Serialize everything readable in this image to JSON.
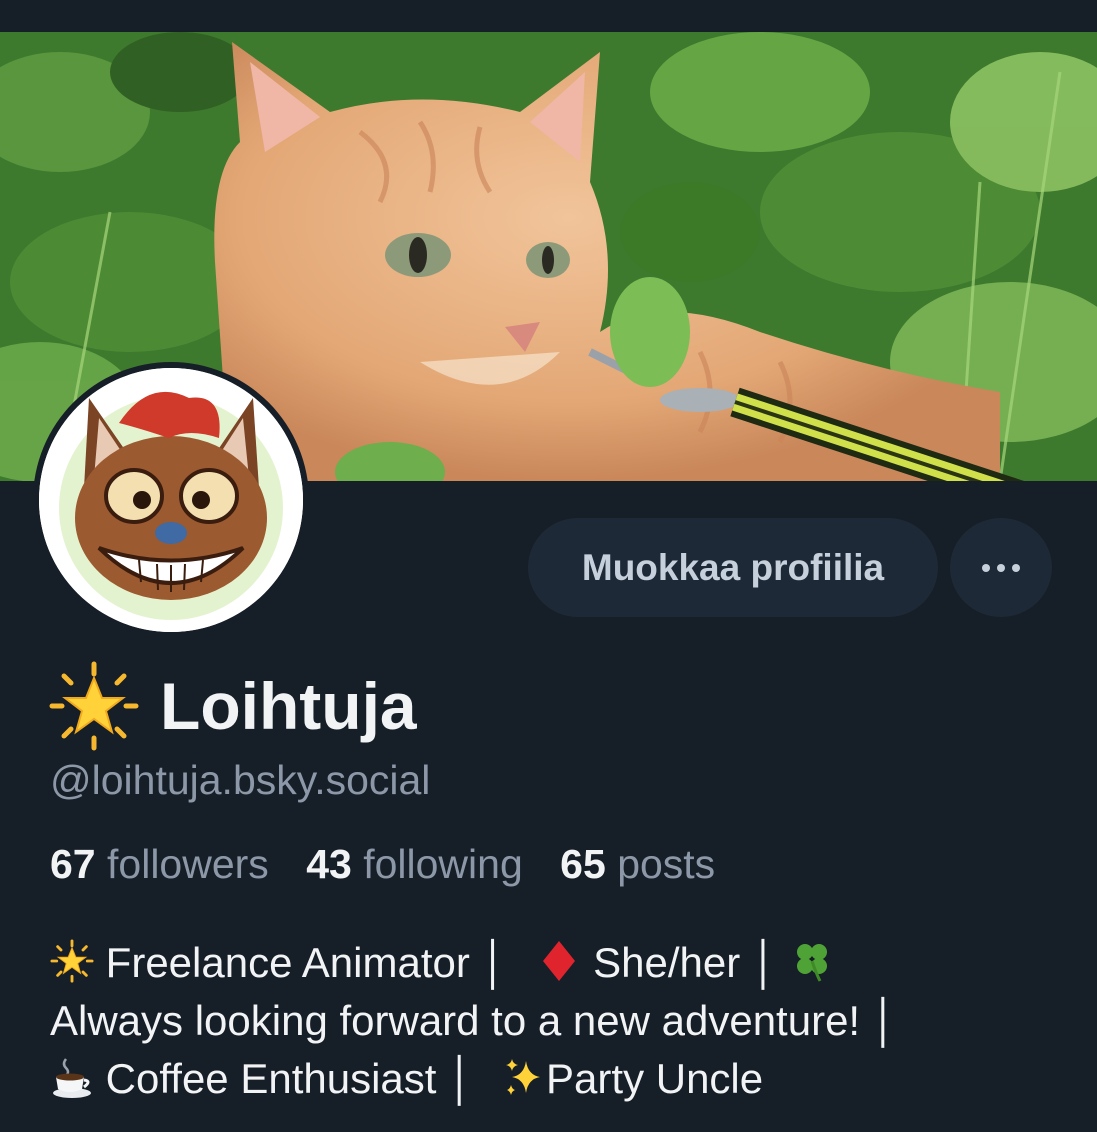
{
  "profile": {
    "display_name": "Loihtuja",
    "name_icon": "glowing-star-icon",
    "handle": "@loihtuja.bsky.social",
    "banner_image": "orange-tabby-cat-in-grass-photo",
    "avatar_image": "cartoon-fox-character-avatar"
  },
  "actions": {
    "edit_profile_label": "Muokkaa profiilia",
    "more_icon": "ellipsis-icon"
  },
  "stats": {
    "followers_count": "67",
    "followers_label": "followers",
    "following_count": "43",
    "following_label": "following",
    "posts_count": "65",
    "posts_label": "posts"
  },
  "bio": {
    "line1_icon1": "glowing-star-icon",
    "line1_text1": "Freelance Animator │",
    "line1_icon2": "red-diamond-icon",
    "line1_text2": "She/her │",
    "line1_icon3": "four-leaf-clover-icon",
    "line2_text": "Always looking forward to a new adventure! │",
    "line3_icon1": "coffee-cup-icon",
    "line3_text1": "Coffee Enthusiast │",
    "line3_icon2": "sparkles-icon",
    "line3_text2": "Party Uncle"
  },
  "colors": {
    "background": "#161e27",
    "button_background": "#1e2937",
    "primary_text": "#f1f3f5",
    "secondary_text": "#8c98a8"
  }
}
